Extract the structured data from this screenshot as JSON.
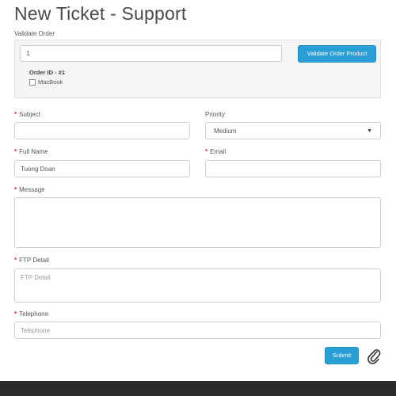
{
  "header": {
    "title": "New Ticket - Support"
  },
  "validate": {
    "section_label": "Validate Order",
    "order_input_value": "1",
    "button_label": "Validate Order Product",
    "order_id_label": "Order ID - #1",
    "product_label": "MacBook"
  },
  "form": {
    "subject": {
      "label": "Subject",
      "value": ""
    },
    "priority": {
      "label": "Priority",
      "selected": "Medium"
    },
    "full_name": {
      "label": "Full Name",
      "value": "Tuong Doan"
    },
    "email": {
      "label": "Email",
      "value": ""
    },
    "message": {
      "label": "Message",
      "value": ""
    },
    "ftp_detail": {
      "label": "FTP Detail",
      "placeholder": "FTP Detail"
    },
    "telephone": {
      "label": "Telephone",
      "placeholder": "Telephone"
    },
    "required_marker": "*",
    "submit_label": "Submit"
  },
  "icons": {
    "attach": "paperclip-icon",
    "checkbox": "checkbox-icon",
    "dropdown": "caret-down-icon"
  },
  "colors": {
    "accent": "#2a9fd6",
    "required": "#d9363e",
    "footer": "#2b2b2b"
  }
}
